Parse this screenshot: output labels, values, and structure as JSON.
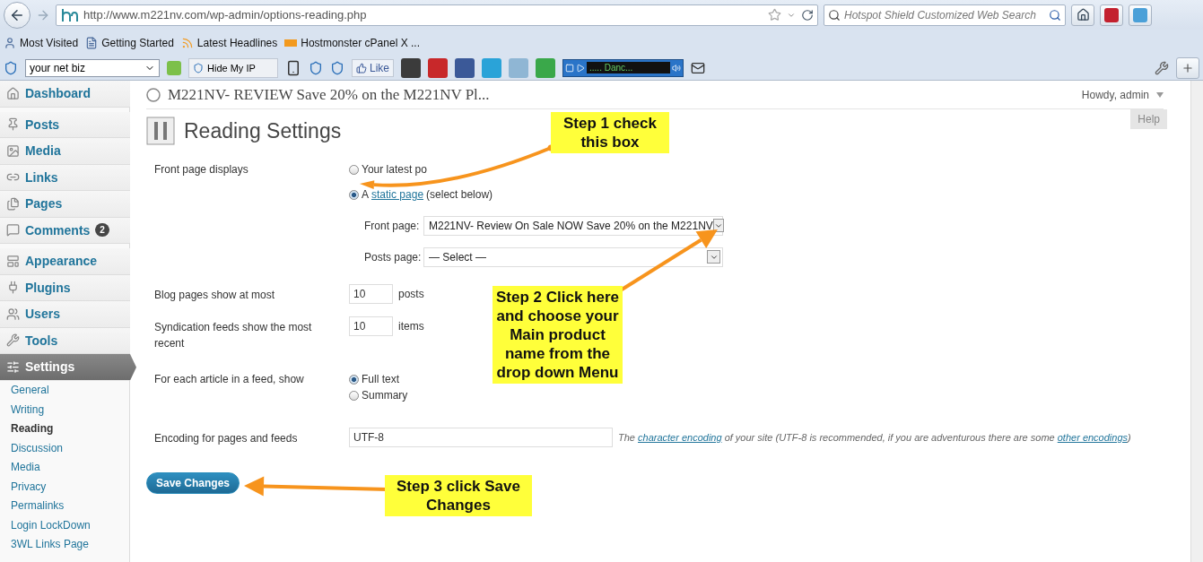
{
  "browser": {
    "url": "http://www.m221nv.com/wp-admin/options-reading.php",
    "search_placeholder": "Hotspot Shield Customized Web Search",
    "bookmarks": [
      {
        "label": "Most Visited",
        "kind": "person"
      },
      {
        "label": "Getting Started",
        "kind": "page"
      },
      {
        "label": "Latest Headlines",
        "kind": "feed"
      },
      {
        "label": "Hostmonster cPanel X ...",
        "kind": "cpanel"
      }
    ],
    "toolbar": {
      "search_value": "your net biz",
      "hide_ip": "Hide My IP",
      "like": "Like",
      "player_track": "..... Danc..."
    }
  },
  "wp": {
    "site_title": "M221NV- REVIEW Save 20% on the M221NV Pl...",
    "greeting": "Howdy, admin",
    "help": "Help",
    "menu": [
      {
        "label": "Dashboard",
        "selected": false
      },
      {
        "label": "Posts",
        "selected": false
      },
      {
        "label": "Media",
        "selected": false
      },
      {
        "label": "Links",
        "selected": false
      },
      {
        "label": "Pages",
        "selected": false
      },
      {
        "label": "Comments",
        "selected": false,
        "badge": "2"
      },
      {
        "label": "Appearance",
        "selected": false
      },
      {
        "label": "Plugins",
        "selected": false
      },
      {
        "label": "Users",
        "selected": false
      },
      {
        "label": "Tools",
        "selected": false
      },
      {
        "label": "Settings",
        "selected": true
      }
    ],
    "submenu": [
      {
        "label": "General",
        "selected": false
      },
      {
        "label": "Writing",
        "selected": false
      },
      {
        "label": "Reading",
        "selected": true
      },
      {
        "label": "Discussion",
        "selected": false
      },
      {
        "label": "Media",
        "selected": false
      },
      {
        "label": "Privacy",
        "selected": false
      },
      {
        "label": "Permalinks",
        "selected": false
      },
      {
        "label": "Login LockDown",
        "selected": false
      },
      {
        "label": "3WL Links Page",
        "selected": false
      }
    ],
    "page_title": "Reading Settings",
    "front_page": {
      "label": "Front page displays",
      "options": [
        {
          "before": "Your latest po",
          "selected": false
        },
        {
          "before": "A ",
          "link": "static page",
          "after": " (select below)",
          "selected": true
        }
      ],
      "selects": [
        {
          "label": "Front page:",
          "value": "M221NV- Review On Sale NOW Save 20% on the M221NV"
        },
        {
          "label": "Posts page:",
          "value": "— Select —"
        }
      ]
    },
    "blog_pages": {
      "label": "Blog pages show at most",
      "value": "10",
      "unit": "posts"
    },
    "syndication": {
      "label": "Syndication feeds show the most recent",
      "value": "10",
      "unit": "items"
    },
    "feed_article": {
      "label": "For each article in a feed, show",
      "options": [
        {
          "label": "Full text",
          "selected": true
        },
        {
          "label": "Summary",
          "selected": false
        }
      ]
    },
    "encoding": {
      "label": "Encoding for pages and feeds",
      "value": "UTF-8",
      "desc_1": "The ",
      "link_1": "character encoding",
      "desc_2": " of your site (UTF-8 is recommended, if you are adventurous there are some ",
      "link_2": "other encodings",
      "desc_3": ")"
    },
    "save": "Save Changes"
  },
  "callouts": [
    {
      "text": "Step 1 check this box"
    },
    {
      "text": "Step 2 Click here and choose your Main product name from the drop down Menu"
    },
    {
      "text": "Step 3 click Save Changes"
    }
  ]
}
